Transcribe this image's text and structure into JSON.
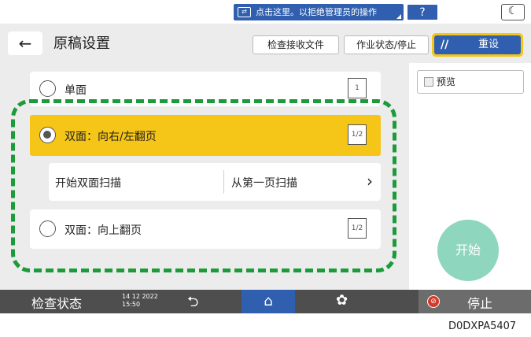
{
  "topbar": {
    "notice_text": "点击这里。以拒绝管理员的操作",
    "help_label": "?",
    "night_icon_glyph": "☾"
  },
  "header": {
    "back_glyph": "←",
    "title": "原稿设置",
    "inbox_label": "检查接收文件",
    "job_label": "作业状态/停止",
    "reset_icon_glyph": "//",
    "reset_label": "重设"
  },
  "options": {
    "single": {
      "label": "单面",
      "selected": false,
      "page_glyph": "1"
    },
    "duplex": {
      "label": "双面：向右/左翻页",
      "selected": true,
      "page_glyph": "1/2"
    },
    "duplex_scan": {
      "label": "开始双面扫描",
      "value": "从第一页扫描",
      "chevron": "›"
    },
    "top_flip": {
      "label": "双面：向上翻页",
      "selected": false,
      "page_glyph": "1/2"
    }
  },
  "right": {
    "preview_label": "预览",
    "preview_checked": false,
    "start_label": "开始"
  },
  "bottombar": {
    "check_status": "检查状态",
    "date_line1": "14 12 2022",
    "date_line2": "15:50",
    "undo_glyph": "⮌",
    "home_glyph": "⌂",
    "gear_glyph": "✿",
    "stop_glyph": "⊘",
    "stop_label": "停止"
  },
  "caption": "D0DXPA5407",
  "colors": {
    "accent_blue": "#2f5fae",
    "selected_yellow": "#f5c518",
    "highlight_green": "#1d9a3a",
    "start_teal": "#8fd6bf",
    "stop_red": "#d43a2a"
  }
}
